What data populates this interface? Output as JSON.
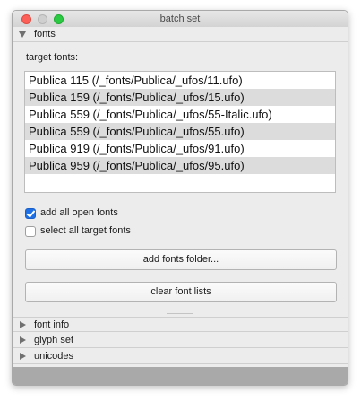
{
  "window": {
    "title": "batch set"
  },
  "fonts_section": {
    "header": "fonts",
    "target_label": "target fonts:",
    "target_fonts": [
      "Publica 115 (/_fonts/Publica/_ufos/11.ufo)",
      "Publica 159 (/_fonts/Publica/_ufos/15.ufo)",
      "Publica 559 (/_fonts/Publica/_ufos/55-Italic.ufo)",
      "Publica 559 (/_fonts/Publica/_ufos/55.ufo)",
      "Publica 919 (/_fonts/Publica/_ufos/91.ufo)",
      "Publica 959 (/_fonts/Publica/_ufos/95.ufo)"
    ],
    "add_all_open_fonts": {
      "label": "add all open fonts",
      "checked": true
    },
    "select_all_target_fonts": {
      "label": "select all target fonts",
      "checked": false
    },
    "add_folder_button": "add fonts folder...",
    "clear_button": "clear font lists"
  },
  "collapsed_sections": [
    "font info",
    "glyph set",
    "unicodes"
  ],
  "colors": {
    "accent": "#1f6fe5",
    "close": "#fc5f57",
    "zoom": "#2acb42"
  }
}
